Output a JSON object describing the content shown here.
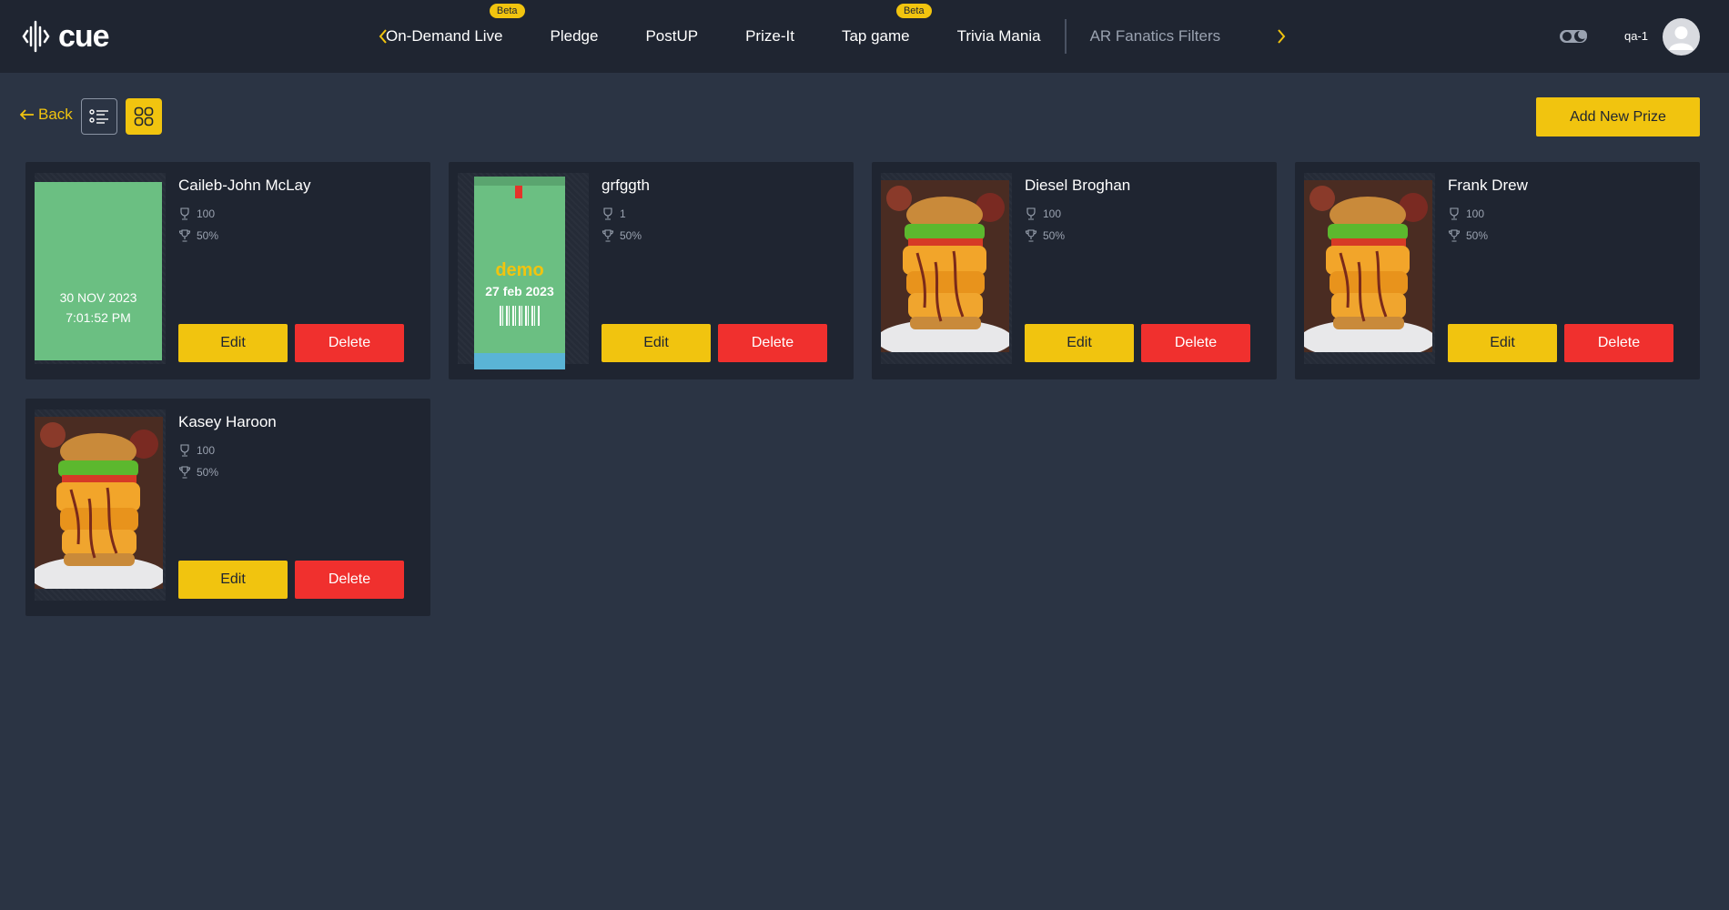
{
  "header": {
    "logo_text": "cue",
    "tabs": [
      {
        "label": "On-Demand Live",
        "badge": "Beta"
      },
      {
        "label": "Pledge",
        "badge": ""
      },
      {
        "label": "PostUP",
        "badge": ""
      },
      {
        "label": "Prize-It",
        "badge": ""
      },
      {
        "label": "Tap game",
        "badge": "Beta"
      },
      {
        "label": "Trivia Mania",
        "badge": ""
      },
      {
        "label": "AR Fanatics Filters",
        "badge": ""
      }
    ],
    "username": "qa-1"
  },
  "toolbar": {
    "back_label": "Back",
    "add_label": "Add New Prize"
  },
  "cards": [
    {
      "title": "Caileb-John McLay",
      "quantity": "100",
      "percent": "50%",
      "image_date": "30 NOV 2023",
      "image_time": "7:01:52 PM",
      "edit": "Edit",
      "delete": "Delete"
    },
    {
      "title": "grfggth",
      "quantity": "1",
      "percent": "50%",
      "image_word": "demo",
      "image_date": "27 feb 2023",
      "edit": "Edit",
      "delete": "Delete"
    },
    {
      "title": "Diesel Broghan",
      "quantity": "100",
      "percent": "50%",
      "edit": "Edit",
      "delete": "Delete"
    },
    {
      "title": "Frank Drew",
      "quantity": "100",
      "percent": "50%",
      "edit": "Edit",
      "delete": "Delete"
    },
    {
      "title": "Kasey Haroon",
      "quantity": "100",
      "percent": "50%",
      "edit": "Edit",
      "delete": "Delete"
    }
  ],
  "colors": {
    "background": "#2b3444",
    "header": "#1f2531",
    "accent": "#f1c40f",
    "danger": "#f0302e"
  }
}
